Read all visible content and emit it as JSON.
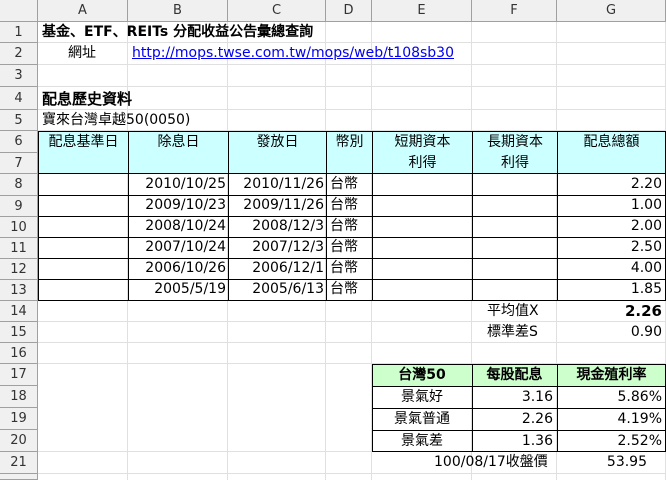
{
  "columns": [
    "A",
    "B",
    "C",
    "D",
    "E",
    "F",
    "G"
  ],
  "rows": [
    "1",
    "2",
    "3",
    "4",
    "5",
    "6",
    "7",
    "8",
    "9",
    "10",
    "11",
    "12",
    "13",
    "14",
    "15",
    "16",
    "17",
    "18",
    "19",
    "20",
    "21"
  ],
  "title": "基金、ETF、REITs 分配收益公告彙總查詢",
  "url_label": "網址",
  "url": "http://mops.twse.com.tw/mops/web/t108sb30",
  "section_title": "配息歷史資料",
  "fund_name": "寶來台灣卓越50(0050)",
  "table_headers": {
    "base_date": "配息基準日",
    "ex_date": "除息日",
    "pay_date": "發放日",
    "currency": "幣別",
    "short_gain_1": "短期資本",
    "short_gain_2": "利得",
    "long_gain_1": "長期資本",
    "long_gain_2": "利得",
    "total": "配息總額"
  },
  "dividends": [
    {
      "ex_date": "2010/10/25",
      "pay_date": "2010/11/26",
      "currency": "台幣",
      "total": "2.20"
    },
    {
      "ex_date": "2009/10/23",
      "pay_date": "2009/11/26",
      "currency": "台幣",
      "total": "1.00"
    },
    {
      "ex_date": "2008/10/24",
      "pay_date": "2008/12/3",
      "currency": "台幣",
      "total": "2.00"
    },
    {
      "ex_date": "2007/10/24",
      "pay_date": "2007/12/3",
      "currency": "台幣",
      "total": "2.50"
    },
    {
      "ex_date": "2006/10/26",
      "pay_date": "2006/12/1",
      "currency": "台幣",
      "total": "4.00"
    },
    {
      "ex_date": "2005/5/19",
      "pay_date": "2005/6/13",
      "currency": "台幣",
      "total": "1.85"
    }
  ],
  "stats": {
    "mean_label": "平均值X",
    "mean_value": "2.26",
    "std_label": "標準差S",
    "std_value": "0.90"
  },
  "scenario_table": {
    "header": [
      "台灣50",
      "每股配息",
      "現金殖利率"
    ],
    "rows": [
      [
        "景氣好",
        "3.16",
        "5.86%"
      ],
      [
        "景氣普通",
        "2.26",
        "4.19%"
      ],
      [
        "景氣差",
        "1.36",
        "2.52%"
      ]
    ],
    "close_label": "100/08/17收盤價",
    "close_value": "53.95"
  },
  "colors": {
    "header_fill": "#ccffff",
    "scenario_header_fill": "#ccffcc",
    "link": "#0000ee"
  }
}
